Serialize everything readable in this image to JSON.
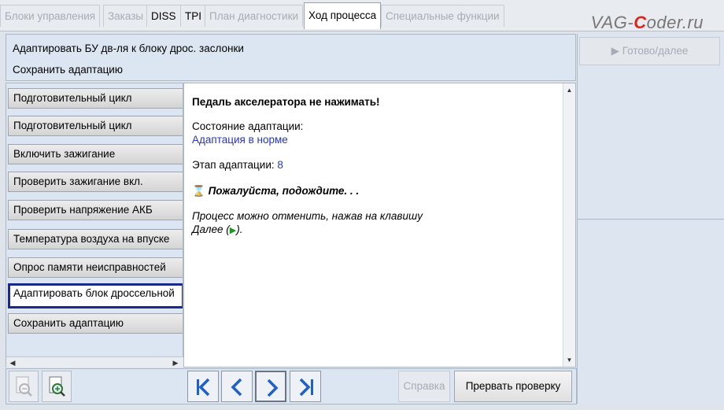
{
  "tabs": [
    {
      "label": "Блоки управления",
      "state": "disabled"
    },
    {
      "label": "Заказы",
      "state": "disabled"
    },
    {
      "label": "DISS",
      "state": "enabled"
    },
    {
      "label": "TPI",
      "state": "enabled"
    },
    {
      "label": "План диагностики",
      "state": "disabled"
    },
    {
      "label": "Ход процесса",
      "state": "active"
    },
    {
      "label": "Специальные функции",
      "state": "disabled"
    }
  ],
  "brand": {
    "prefix": "VAG-",
    "accent": "C",
    "suffix": "oder.ru"
  },
  "header": {
    "line1": "Адаптировать БУ дв-ля к блоку дрос. заслонки",
    "line2": "Сохранить адаптацию"
  },
  "right_panel": {
    "done_label": "▶ Готово/далее"
  },
  "steps": [
    {
      "label": "Подготовительный цикл"
    },
    {
      "label": "Подготовительный цикл"
    },
    {
      "label": "Включить зажигание"
    },
    {
      "label": "Проверить зажигание вкл."
    },
    {
      "label": "Проверить напряжение АКБ"
    },
    {
      "label": "Температура воздуха на впуске"
    },
    {
      "label": "Опрос памяти неисправностей"
    },
    {
      "label": "Адаптировать блок дроссельной"
    },
    {
      "label": "Сохранить адаптацию"
    }
  ],
  "content": {
    "warning": "Педаль акселератора не нажимать!",
    "state_label": "Состояние адаптации:",
    "state_value": "Адаптация в норме",
    "stage_label": "Этап адаптации:",
    "stage_value": "8",
    "wait_text": "Пожалуйста, подождите. . .",
    "cancel_line1": "Процесс можно отменить, нажав на клавишу",
    "cancel_line2_pre": "Далее (",
    "cancel_line2_post": ")."
  },
  "toolbar": {
    "help_label": "Справка",
    "abort_label": "Прервать проверку"
  },
  "colors": {
    "accent_blue": "#2434c8",
    "active_step_border": "#1b2a8a",
    "nav_arrow": "#1f5fc8",
    "brand_red": "#e2231a",
    "play_green": "#1a9a1a"
  }
}
